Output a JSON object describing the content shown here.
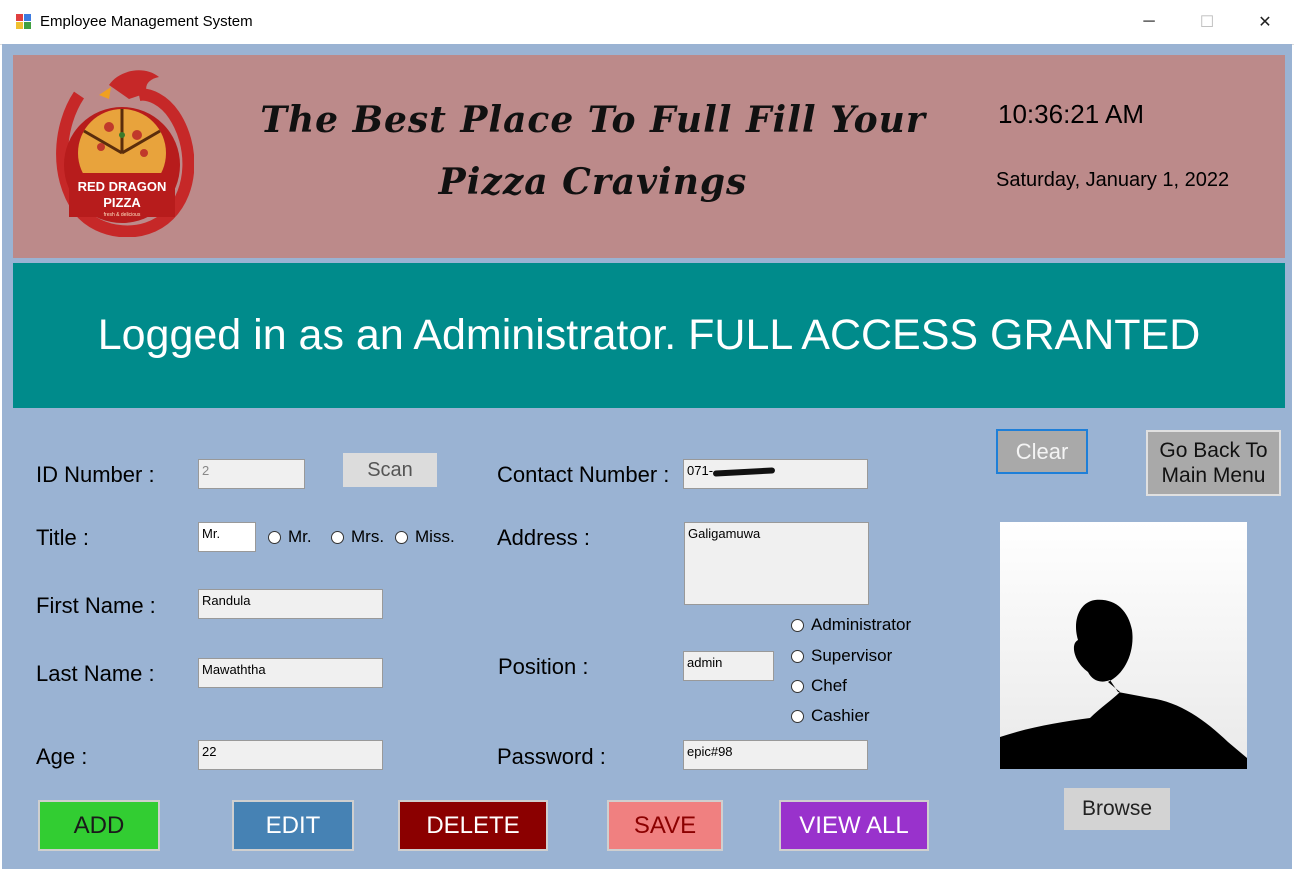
{
  "window": {
    "title": "Employee Management System",
    "minimize_glyph": "─",
    "maximize_glyph": "☐",
    "close_glyph": "✕"
  },
  "banner": {
    "logo_text": "RED DRAGON PIZZA",
    "logo_subtext": "fresh & delicious",
    "tagline_line1": "The Best Place To Full Fill Your",
    "tagline_line2": "Pizza Cravings",
    "time": "10:36:21 AM",
    "date": "Saturday, January 1, 2022"
  },
  "access_message": "Logged in as an Administrator. FULL ACCESS GRANTED",
  "form": {
    "id_label": "ID Number :",
    "id_value": "2",
    "scan_button": "Scan",
    "title_label": "Title :",
    "title_value": "Mr.",
    "title_options": [
      "Mr.",
      "Mrs.",
      "Miss."
    ],
    "first_name_label": "First Name :",
    "first_name_value": "Randula",
    "last_name_label": "Last Name :",
    "last_name_value": "Mawaththa",
    "age_label": "Age :",
    "age_value": "22",
    "contact_label": "Contact Number :",
    "contact_value": "071-",
    "address_label": "Address :",
    "address_value": "Galigamuwa",
    "position_label": "Position :",
    "position_value": "admin",
    "position_options": [
      "Administrator",
      "Supervisor",
      "Chef",
      "Cashier"
    ],
    "password_label": "Password :",
    "password_value": "epic#98"
  },
  "side": {
    "clear_button": "Clear",
    "back_button_line1": "Go Back To",
    "back_button_line2": "Main Menu",
    "browse_button": "Browse"
  },
  "actions": {
    "add": "ADD",
    "edit": "EDIT",
    "delete": "DELETE",
    "save": "SAVE",
    "view_all": "VIEW ALL"
  },
  "colors": {
    "form_background": "#9ab3d3",
    "banner": "#bc8a8a",
    "access_bar": "#008b8b",
    "add": "#32cd32",
    "edit": "#4682b4",
    "delete": "#8b0000",
    "save": "#f08080",
    "view_all": "#9932cc"
  }
}
